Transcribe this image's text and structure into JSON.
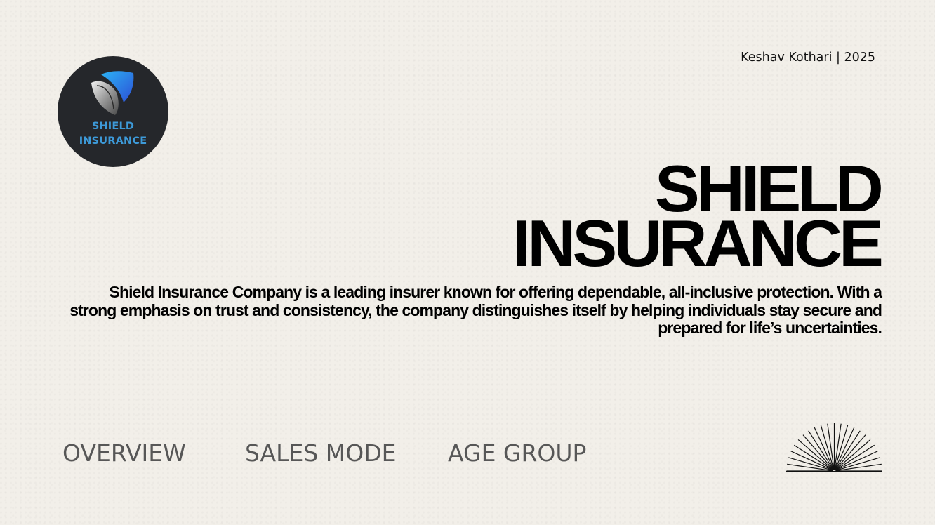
{
  "logo": {
    "line1": "SHIELD",
    "line2": "INSURANCE",
    "bg_color": "#25272b",
    "text_color": "#3d9ad9",
    "icon": "shield-logo-icon"
  },
  "header": {
    "author": "Keshav Kothari | 2025"
  },
  "hero": {
    "title_line1": "SHIELD",
    "title_line2": "INSURANCE",
    "description": "Shield Insurance Company is a leading insurer known for offering dependable, all-inclusive protection. With a strong emphasis on trust and consistency, the company distinguishes itself by helping individuals stay secure and prepared for life’s uncertainties."
  },
  "nav": {
    "items": [
      {
        "label": "OVERVIEW"
      },
      {
        "label": "SALES MODE"
      },
      {
        "label": "AGE GROUP"
      }
    ]
  },
  "decor": {
    "icon": "sunburst-icon"
  },
  "colors": {
    "background": "#f2efe9",
    "nav_text": "#575757",
    "text": "#000000"
  }
}
